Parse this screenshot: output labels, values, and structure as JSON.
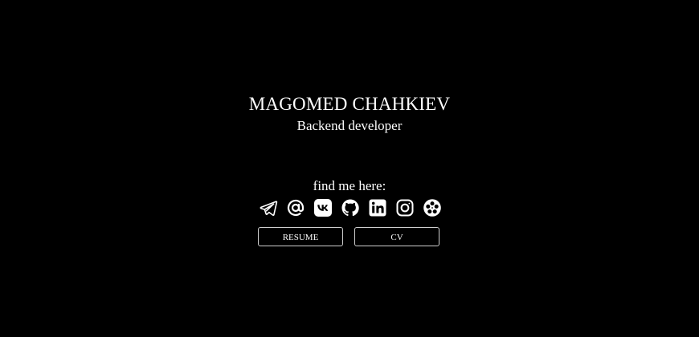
{
  "profile": {
    "name": "MAGOMED CHAHKIEV",
    "role": "Backend developer"
  },
  "links": {
    "heading": "find me here:",
    "icons": [
      "telegram-icon",
      "email-icon",
      "vk-icon",
      "github-icon",
      "linkedin-icon",
      "instagram-icon",
      "film-reel-icon"
    ]
  },
  "buttons": {
    "resume": "RESUME",
    "cv": "CV"
  },
  "colors": {
    "background": "#000000",
    "text": "#ffffff",
    "button_border": "#cfcfcf"
  }
}
